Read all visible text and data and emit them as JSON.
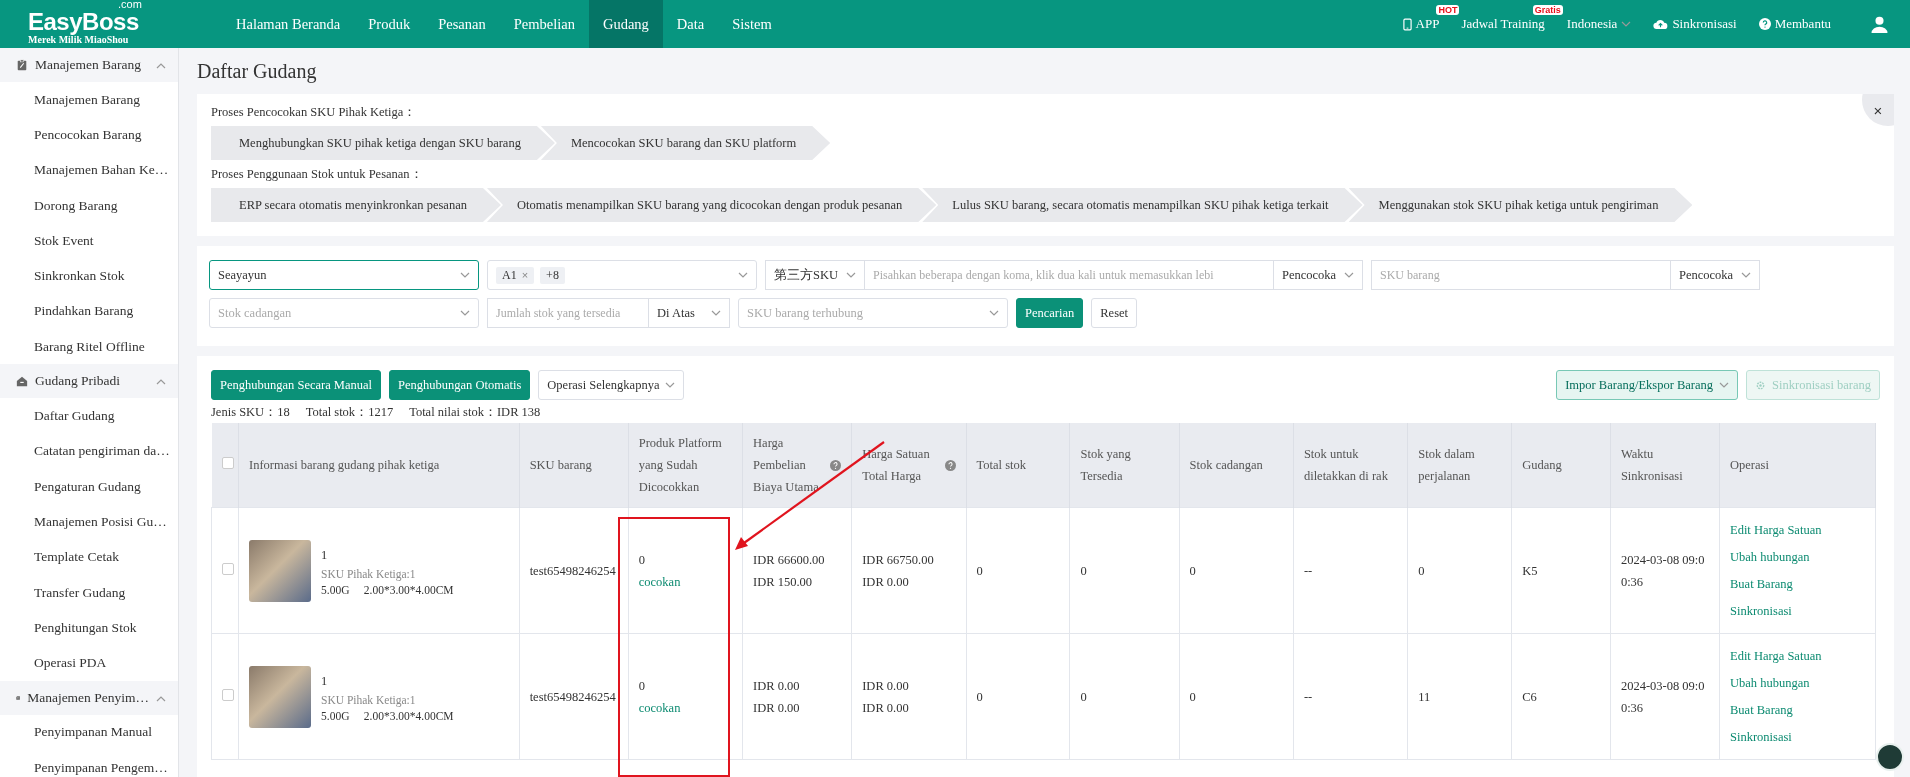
{
  "header": {
    "logo": "EasyBoss",
    "logo_suffix": ".com",
    "logo_sub": "Merek Milik MiaoShou",
    "nav": [
      {
        "label": "Halaman Beranda",
        "selected": false
      },
      {
        "label": "Produk",
        "selected": false
      },
      {
        "label": "Pesanan",
        "selected": false
      },
      {
        "label": "Pembelian",
        "selected": false
      },
      {
        "label": "Gudang",
        "selected": true
      },
      {
        "label": "Data",
        "selected": false
      },
      {
        "label": "Sistem",
        "selected": false
      }
    ],
    "tools": [
      {
        "kind": "app",
        "label": "APP",
        "badge": "HOT"
      },
      {
        "kind": "training",
        "label": "Jadwal Training",
        "badge": "Gratis"
      },
      {
        "kind": "language",
        "label": "Indonesia"
      },
      {
        "kind": "sync",
        "label": "Sinkronisasi"
      },
      {
        "kind": "help",
        "label": "Membantu"
      },
      {
        "kind": "user"
      }
    ]
  },
  "sidebar": [
    {
      "label": "Manajemen Barang",
      "expanded": true,
      "children": [
        {
          "label": "Manajemen Barang"
        },
        {
          "label": "Pencocokan Barang"
        },
        {
          "label": "Manajemen Bahan Ke…"
        },
        {
          "label": "Dorong Barang"
        },
        {
          "label": "Stok Event"
        },
        {
          "label": "Sinkronkan Stok"
        },
        {
          "label": "Pindahkan Barang"
        },
        {
          "label": "Barang Ritel Offline"
        }
      ]
    },
    {
      "label": "Gudang Pribadi",
      "expanded": true,
      "children": [
        {
          "label": "Daftar Gudang"
        },
        {
          "label": "Catatan pengiriman da…"
        },
        {
          "label": "Pengaturan Gudang"
        },
        {
          "label": "Manajemen Posisi Gu…"
        },
        {
          "label": "Template Cetak"
        },
        {
          "label": "Transfer Gudang"
        },
        {
          "label": "Penghitungan Stok"
        },
        {
          "label": "Operasi PDA"
        }
      ]
    },
    {
      "label": "Manajemen Penyim…",
      "expanded": true,
      "children": [
        {
          "label": "Penyimpanan Manual"
        },
        {
          "label": "Penyimpanan Pengem…"
        }
      ]
    }
  ],
  "page_title": "Daftar Gudang",
  "processes": [
    {
      "title": "Proses Pencocokan SKU Pihak Ketiga：",
      "steps": [
        "Menghubungkan SKU pihak ketiga dengan SKU barang",
        "Mencocokan SKU barang dan SKU platform"
      ]
    },
    {
      "title": "Proses Penggunaan Stok untuk Pesanan：",
      "steps": [
        "ERP secara otomatis menyinkronkan pesanan",
        "Otomatis menampilkan SKU barang yang dicocokan dengan produk pesanan",
        "Lulus SKU barang, secara otomatis menampilkan SKU pihak ketiga terkait",
        "Menggunakan stok SKU pihak ketiga untuk pengiriman"
      ]
    }
  ],
  "close_label": "×",
  "filters": {
    "warehouse": {
      "value": "Seayayun"
    },
    "tags": {
      "tags": [
        "A1"
      ],
      "tag_close": "×",
      "more": "+8"
    },
    "sku_type": {
      "value": "第三方SKU"
    },
    "sku_input": {
      "placeholder": "Pisahkan beberapa dengan koma, klik dua kali untuk memasukkan lebi"
    },
    "match1": {
      "value": "Pencocoka"
    },
    "sku_barang": {
      "placeholder": "SKU barang"
    },
    "match2": {
      "value": "Pencocoka"
    },
    "reserve": {
      "placeholder": "Stok cadangan"
    },
    "qty": {
      "placeholder": "Jumlah stok yang tersedia"
    },
    "qty_op": {
      "value": "Di Atas"
    },
    "linked": {
      "placeholder": "SKU barang terhubung"
    },
    "search": "Pencarian",
    "reset": "Reset"
  },
  "actions": {
    "left": [
      {
        "kind": "primary",
        "label": "Penghubungan Secara Manual"
      },
      {
        "kind": "primary",
        "label": "Penghubungan Otomatis"
      },
      {
        "kind": "dropdown",
        "label": "Operasi Selengkapnya"
      }
    ],
    "import": "Impor Barang/Ekspor Barang",
    "sync": "Sinkronisasi barang",
    "sync_disabled": true
  },
  "stats": [
    {
      "label": "Jenis SKU：",
      "value": "18"
    },
    {
      "label": "Total stok：",
      "value": "1217"
    },
    {
      "label": "Total nilai stok：",
      "value": "IDR 138"
    }
  ],
  "table": {
    "select_all": false,
    "columns": [
      {
        "label": "Informasi barang gudang pihak ketiga"
      },
      {
        "label": "SKU barang"
      },
      {
        "label": "Produk Platform yang Sudah Dicocokkan"
      },
      {
        "label": "Harga Pembelian",
        "sub": "Biaya Utama",
        "help": true
      },
      {
        "label": "Harga Satuan",
        "sub": "Total Harga",
        "help": true
      },
      {
        "label": "Total stok"
      },
      {
        "label": "Stok yang Tersedia"
      },
      {
        "label": "Stok cadangan"
      },
      {
        "label": "Stok untuk diletakkan di rak"
      },
      {
        "label": "Stok dalam perjalanan"
      },
      {
        "label": "Gudang"
      },
      {
        "label": "Waktu Sinkronisasi"
      },
      {
        "label": "Operasi"
      }
    ],
    "rows": [
      {
        "checked": false,
        "name": "1",
        "third_sku": "SKU Pihak Ketiga:1",
        "weight": "5.00G",
        "size": "2.00*3.00*4.00CM",
        "sku": "test65498246254",
        "matched": "0",
        "match_link": "cocokan",
        "purchase": [
          "IDR 66600.00",
          "IDR 150.00"
        ],
        "unit": [
          "IDR 66750.00",
          "IDR 0.00"
        ],
        "total": "0",
        "available": "0",
        "reserved": "0",
        "shelf": "--",
        "transit": "0",
        "warehouse": "K5",
        "sync_time": "2024-03-08 09:00:36",
        "ops": [
          "Edit Harga Satuan",
          "Ubah hubungan",
          "Buat Barang",
          "Sinkronisasi"
        ]
      },
      {
        "checked": false,
        "name": "1",
        "third_sku": "SKU Pihak Ketiga:1",
        "weight": "5.00G",
        "size": "2.00*3.00*4.00CM",
        "sku": "test65498246254",
        "matched": "0",
        "match_link": "cocokan",
        "purchase": [
          "IDR 0.00",
          "IDR 0.00"
        ],
        "unit": [
          "IDR 0.00",
          "IDR 0.00"
        ],
        "total": "0",
        "available": "0",
        "reserved": "0",
        "shelf": "--",
        "transit": "11",
        "warehouse": "C6",
        "sync_time": "2024-03-08 09:00:36",
        "ops": [
          "Edit Harga Satuan",
          "Ubah hubungan",
          "Buat Barang",
          "Sinkronisasi"
        ]
      }
    ]
  }
}
